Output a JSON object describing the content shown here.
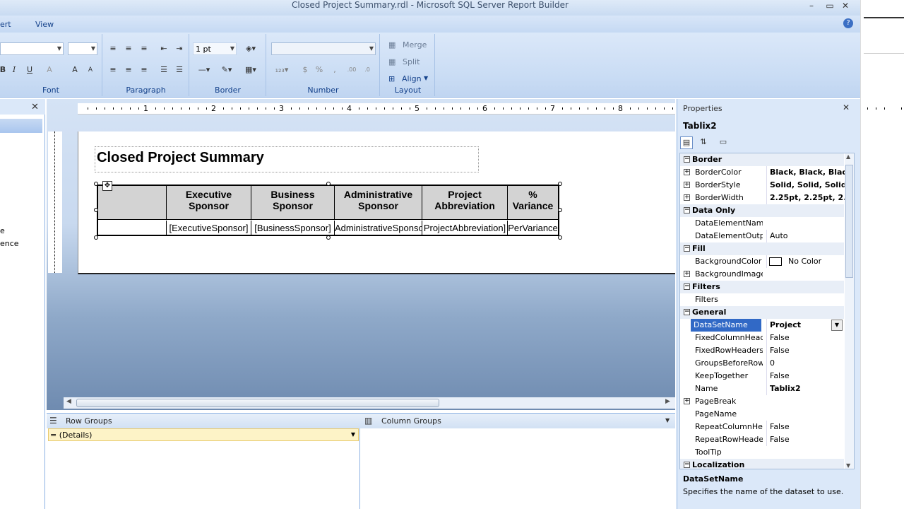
{
  "window": {
    "title": "Closed Project Summary.rdl - Microsoft SQL Server Report Builder"
  },
  "menu": {
    "insert": "ert",
    "view": "View"
  },
  "ribbon": {
    "font_group": "Font",
    "paragraph_group": "Paragraph",
    "border_group": "Border",
    "number_group": "Number",
    "layout_group": "Layout",
    "border_width": "1 pt",
    "merge": "Merge",
    "split": "Split",
    "align": "Align"
  },
  "left_panel": {
    "item1": "e",
    "item2": "ence"
  },
  "report": {
    "title": "Closed Project Summary",
    "headers": [
      "",
      "Executive Sponsor",
      "Business Sponsor",
      "Administrative Sponsor",
      "Project Abbreviation",
      "% Variance"
    ],
    "fields": [
      "",
      "[ExecutiveSponsor]",
      "[BusinessSponsor]",
      "AdministrativeSponso",
      "ProjectAbbreviation]",
      "PerVariance"
    ]
  },
  "ruler": {
    "marks": [
      "1",
      "2",
      "3",
      "4",
      "5",
      "6",
      "7",
      "8"
    ]
  },
  "groups": {
    "row_groups": "Row Groups",
    "column_groups": "Column Groups",
    "details": "= (Details)"
  },
  "properties": {
    "header": "Properties",
    "object": "Tablix2",
    "rows": [
      {
        "type": "cat",
        "name": "Border"
      },
      {
        "type": "prop",
        "expand": true,
        "name": "BorderColor",
        "value": "Black, Black, Black, Bla",
        "bold": true
      },
      {
        "type": "prop",
        "expand": true,
        "name": "BorderStyle",
        "value": "Solid, Solid, Solid, Sol",
        "bold": true
      },
      {
        "type": "prop",
        "expand": true,
        "name": "BorderWidth",
        "value": "2.25pt, 2.25pt, 2.25pt,",
        "bold": true
      },
      {
        "type": "cat",
        "name": "Data Only"
      },
      {
        "type": "prop",
        "name": "DataElementName",
        "value": ""
      },
      {
        "type": "prop",
        "name": "DataElementOutpu",
        "value": "Auto"
      },
      {
        "type": "cat",
        "name": "Fill"
      },
      {
        "type": "prop",
        "name": "BackgroundColor",
        "value": "No Color",
        "swatch": true
      },
      {
        "type": "prop",
        "expand": true,
        "name": "BackgroundImage",
        "value": ""
      },
      {
        "type": "cat",
        "name": "Filters"
      },
      {
        "type": "prop",
        "name": "Filters",
        "value": ""
      },
      {
        "type": "cat",
        "name": "General"
      },
      {
        "type": "prop",
        "name": "DataSetName",
        "value": "Project",
        "bold": true,
        "selected": true
      },
      {
        "type": "prop",
        "name": "FixedColumnHeade",
        "value": "False"
      },
      {
        "type": "prop",
        "name": "FixedRowHeaders",
        "value": "False"
      },
      {
        "type": "prop",
        "name": "GroupsBeforeRow",
        "value": "0"
      },
      {
        "type": "prop",
        "name": "KeepTogether",
        "value": "False"
      },
      {
        "type": "prop",
        "name": "Name",
        "value": "Tablix2",
        "bold": true
      },
      {
        "type": "prop",
        "expand": true,
        "name": "PageBreak",
        "value": ""
      },
      {
        "type": "prop",
        "name": "PageName",
        "value": ""
      },
      {
        "type": "prop",
        "name": "RepeatColumnHea",
        "value": "False"
      },
      {
        "type": "prop",
        "name": "RepeatRowHeader",
        "value": "False"
      },
      {
        "type": "prop",
        "name": "ToolTip",
        "value": ""
      },
      {
        "type": "cat",
        "name": "Localization"
      }
    ],
    "desc_title": "DataSetName",
    "desc_text": "Specifies the name of the dataset to use."
  },
  "colors": {
    "selection": "#3169c6",
    "ribbon": "#c9dcf4",
    "header_cell": "#d3d3d3"
  }
}
